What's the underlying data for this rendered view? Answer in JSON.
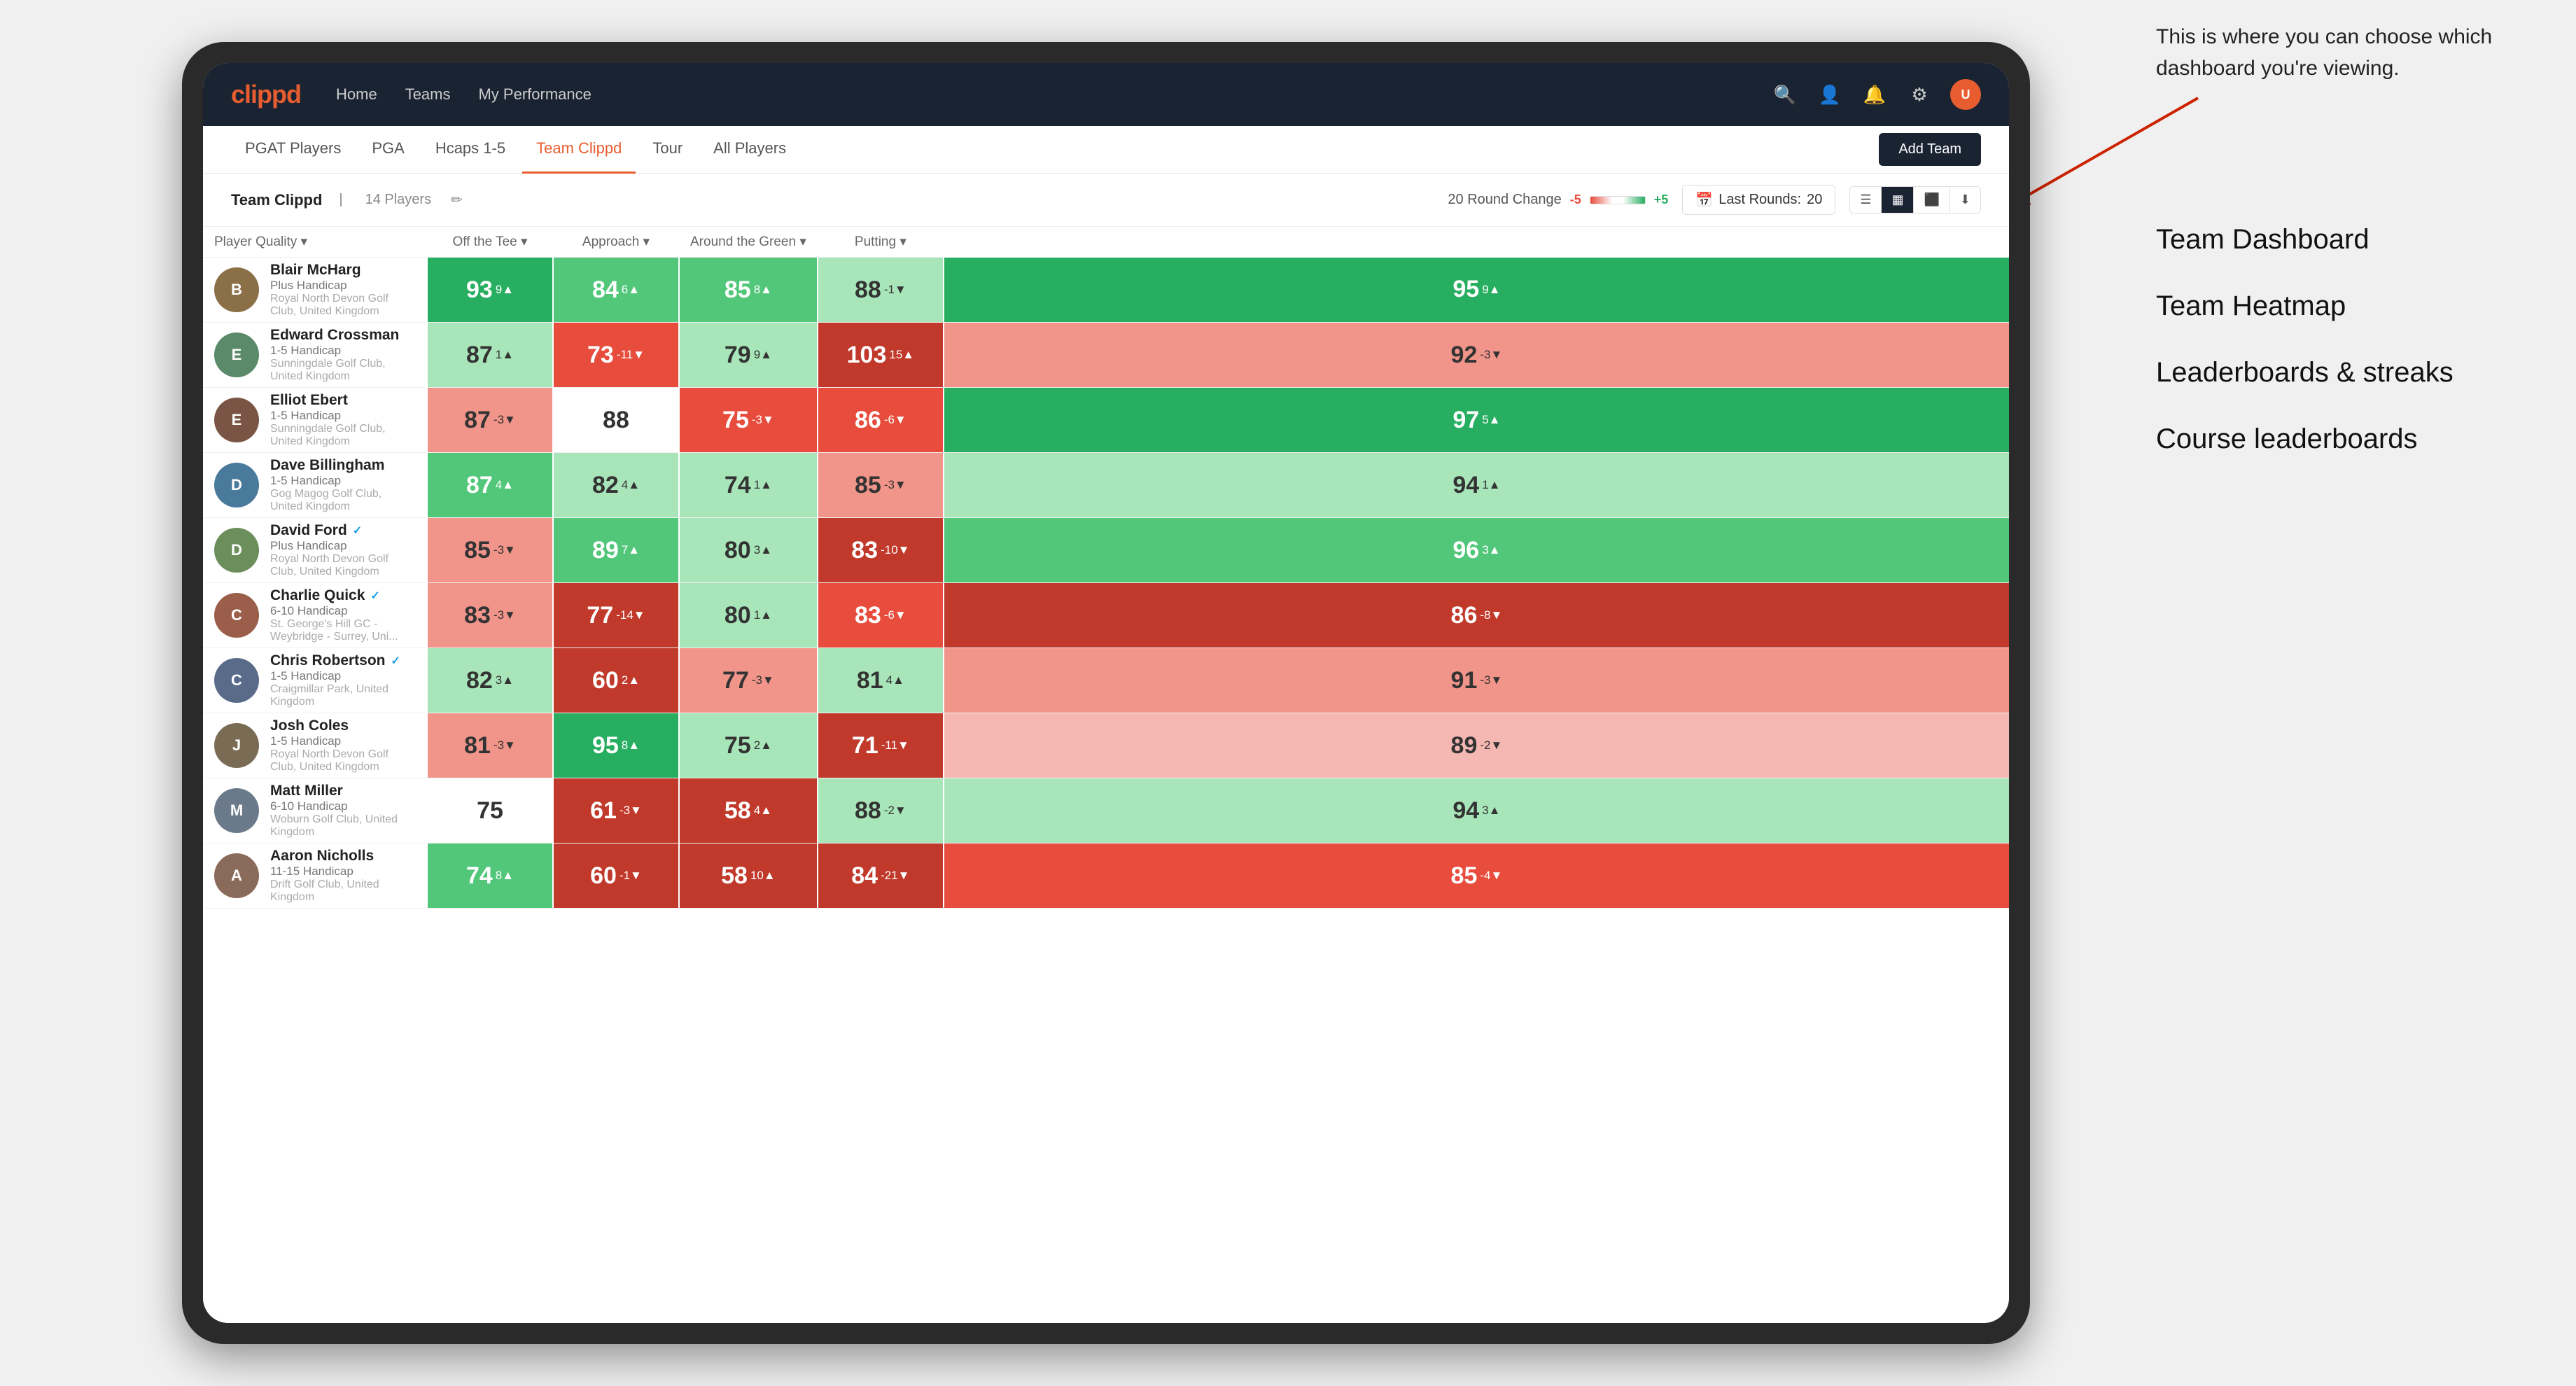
{
  "annotation": {
    "text": "This is where you can choose which dashboard you're viewing.",
    "options": [
      "Team Dashboard",
      "Team Heatmap",
      "Leaderboards & streaks",
      "Course leaderboards"
    ]
  },
  "navbar": {
    "logo": "clippd",
    "links": [
      "Home",
      "Teams",
      "My Performance"
    ],
    "icons": [
      "search",
      "person",
      "bell",
      "settings",
      "avatar"
    ]
  },
  "subnav": {
    "tabs": [
      "PGAT Players",
      "PGA",
      "Hcaps 1-5",
      "Team Clippd",
      "Tour",
      "All Players"
    ],
    "active": "Team Clippd",
    "add_button": "Add Team"
  },
  "toolbar": {
    "team_name": "Team Clippd",
    "player_count": "14 Players",
    "round_change_label": "20 Round Change",
    "scale_neg": "-5",
    "scale_pos": "+5",
    "last_rounds_label": "Last Rounds:",
    "last_rounds_value": "20"
  },
  "table": {
    "columns": [
      "Player Quality ▾",
      "Off the Tee ▾",
      "Approach ▾",
      "Around the Green ▾",
      "Putting ▾"
    ],
    "rows": [
      {
        "name": "Blair McHarg",
        "badge": "",
        "handicap": "Plus Handicap",
        "club": "Royal North Devon Golf Club, United Kingdom",
        "avatar_color": "#8B6F47",
        "scores": [
          {
            "value": "93",
            "change": "9▲",
            "bg": "bg-green-dark"
          },
          {
            "value": "84",
            "change": "6▲",
            "bg": "bg-green-mid"
          },
          {
            "value": "85",
            "change": "8▲",
            "bg": "bg-green-mid"
          },
          {
            "value": "88",
            "change": "-1▼",
            "bg": "bg-green-light"
          },
          {
            "value": "95",
            "change": "9▲",
            "bg": "bg-green-dark"
          }
        ]
      },
      {
        "name": "Edward Crossman",
        "badge": "",
        "handicap": "1-5 Handicap",
        "club": "Sunningdale Golf Club, United Kingdom",
        "avatar_color": "#5a8a6a",
        "scores": [
          {
            "value": "87",
            "change": "1▲",
            "bg": "bg-green-light"
          },
          {
            "value": "73",
            "change": "-11▼",
            "bg": "bg-red-mid"
          },
          {
            "value": "79",
            "change": "9▲",
            "bg": "bg-green-light"
          },
          {
            "value": "103",
            "change": "15▲",
            "bg": "bg-red-dark"
          },
          {
            "value": "92",
            "change": "-3▼",
            "bg": "bg-red-light"
          }
        ]
      },
      {
        "name": "Elliot Ebert",
        "badge": "",
        "handicap": "1-5 Handicap",
        "club": "Sunningdale Golf Club, United Kingdom",
        "avatar_color": "#7a5545",
        "scores": [
          {
            "value": "87",
            "change": "-3▼",
            "bg": "bg-red-light"
          },
          {
            "value": "88",
            "change": "",
            "bg": "bg-white"
          },
          {
            "value": "75",
            "change": "-3▼",
            "bg": "bg-red-mid"
          },
          {
            "value": "86",
            "change": "-6▼",
            "bg": "bg-red-mid"
          },
          {
            "value": "97",
            "change": "5▲",
            "bg": "bg-green-dark"
          }
        ]
      },
      {
        "name": "Dave Billingham",
        "badge": "",
        "handicap": "1-5 Handicap",
        "club": "Gog Magog Golf Club, United Kingdom",
        "avatar_color": "#4a7a9b",
        "scores": [
          {
            "value": "87",
            "change": "4▲",
            "bg": "bg-green-mid"
          },
          {
            "value": "82",
            "change": "4▲",
            "bg": "bg-green-light"
          },
          {
            "value": "74",
            "change": "1▲",
            "bg": "bg-green-light"
          },
          {
            "value": "85",
            "change": "-3▼",
            "bg": "bg-red-light"
          },
          {
            "value": "94",
            "change": "1▲",
            "bg": "bg-green-light"
          }
        ]
      },
      {
        "name": "David Ford",
        "badge": "verified",
        "handicap": "Plus Handicap",
        "club": "Royal North Devon Golf Club, United Kingdom",
        "avatar_color": "#6b8e5a",
        "scores": [
          {
            "value": "85",
            "change": "-3▼",
            "bg": "bg-red-light"
          },
          {
            "value": "89",
            "change": "7▲",
            "bg": "bg-green-mid"
          },
          {
            "value": "80",
            "change": "3▲",
            "bg": "bg-green-light"
          },
          {
            "value": "83",
            "change": "-10▼",
            "bg": "bg-red-dark"
          },
          {
            "value": "96",
            "change": "3▲",
            "bg": "bg-green-mid"
          }
        ]
      },
      {
        "name": "Charlie Quick",
        "badge": "verified",
        "handicap": "6-10 Handicap",
        "club": "St. George's Hill GC - Weybridge - Surrey, Uni...",
        "avatar_color": "#9b5e4a",
        "scores": [
          {
            "value": "83",
            "change": "-3▼",
            "bg": "bg-red-light"
          },
          {
            "value": "77",
            "change": "-14▼",
            "bg": "bg-red-dark"
          },
          {
            "value": "80",
            "change": "1▲",
            "bg": "bg-green-light"
          },
          {
            "value": "83",
            "change": "-6▼",
            "bg": "bg-red-mid"
          },
          {
            "value": "86",
            "change": "-8▼",
            "bg": "bg-red-dark"
          }
        ]
      },
      {
        "name": "Chris Robertson",
        "badge": "verified",
        "handicap": "1-5 Handicap",
        "club": "Craigmillar Park, United Kingdom",
        "avatar_color": "#5a6b8a",
        "scores": [
          {
            "value": "82",
            "change": "3▲",
            "bg": "bg-green-light"
          },
          {
            "value": "60",
            "change": "2▲",
            "bg": "bg-red-dark"
          },
          {
            "value": "77",
            "change": "-3▼",
            "bg": "bg-red-light"
          },
          {
            "value": "81",
            "change": "4▲",
            "bg": "bg-green-light"
          },
          {
            "value": "91",
            "change": "-3▼",
            "bg": "bg-red-light"
          }
        ]
      },
      {
        "name": "Josh Coles",
        "badge": "",
        "handicap": "1-5 Handicap",
        "club": "Royal North Devon Golf Club, United Kingdom",
        "avatar_color": "#7a6b55",
        "scores": [
          {
            "value": "81",
            "change": "-3▼",
            "bg": "bg-red-light"
          },
          {
            "value": "95",
            "change": "8▲",
            "bg": "bg-green-dark"
          },
          {
            "value": "75",
            "change": "2▲",
            "bg": "bg-green-light"
          },
          {
            "value": "71",
            "change": "-11▼",
            "bg": "bg-red-dark"
          },
          {
            "value": "89",
            "change": "-2▼",
            "bg": "bg-salmon"
          }
        ]
      },
      {
        "name": "Matt Miller",
        "badge": "",
        "handicap": "6-10 Handicap",
        "club": "Woburn Golf Club, United Kingdom",
        "avatar_color": "#6a7a8a",
        "scores": [
          {
            "value": "75",
            "change": "",
            "bg": "bg-white"
          },
          {
            "value": "61",
            "change": "-3▼",
            "bg": "bg-red-dark"
          },
          {
            "value": "58",
            "change": "4▲",
            "bg": "bg-red-dark"
          },
          {
            "value": "88",
            "change": "-2▼",
            "bg": "bg-green-light"
          },
          {
            "value": "94",
            "change": "3▲",
            "bg": "bg-green-light"
          }
        ]
      },
      {
        "name": "Aaron Nicholls",
        "badge": "",
        "handicap": "11-15 Handicap",
        "club": "Drift Golf Club, United Kingdom",
        "avatar_color": "#8a6a5a",
        "scores": [
          {
            "value": "74",
            "change": "8▲",
            "bg": "bg-green-mid"
          },
          {
            "value": "60",
            "change": "-1▼",
            "bg": "bg-red-dark"
          },
          {
            "value": "58",
            "change": "10▲",
            "bg": "bg-red-dark"
          },
          {
            "value": "84",
            "change": "-21▼",
            "bg": "bg-red-dark"
          },
          {
            "value": "85",
            "change": "-4▼",
            "bg": "bg-red-mid"
          }
        ]
      }
    ]
  }
}
